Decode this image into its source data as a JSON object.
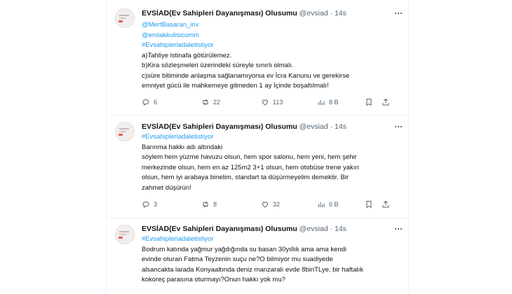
{
  "tweets": [
    {
      "name": "EVSİAD(Ev Sahipleri Dayanışması) Olusumu",
      "handle": "@evsiad",
      "sep": "·",
      "time": "14s",
      "lines": [
        {
          "text": "@MertBasaran_inv",
          "link": true
        },
        {
          "text": "@emlakkulisicomm",
          "link": true
        },
        {
          "text": "#Evsahipleriadaletistiyor",
          "link": true
        },
        {
          "text": "a)Tahliye istinafa götürülemez.",
          "link": false
        },
        {
          "text": "b)Kira sözleşmeleri üzerindeki süreyle sınırlı olmalı.",
          "link": false
        },
        {
          "text": "c)süre bitiminde anlaşma sağlanamıyorsa ev İcra Kanunu ve gerekirse",
          "link": false
        },
        {
          "text": "emniyet gücü ile mahkemeye gitmeden 1 ay İçinde boşaltılmalı!",
          "link": false
        }
      ],
      "replies": "6",
      "retweets": "22",
      "likes": "113",
      "views": "8 B"
    },
    {
      "name": "EVSİAD(Ev Sahipleri Dayanışması) Olusumu",
      "handle": "@evsiad",
      "sep": "·",
      "time": "14s",
      "lines": [
        {
          "text": "#Evsahipleriadaletistiyor",
          "link": true
        },
        {
          "text": "Barınma hakkı adı altındaki",
          "link": false
        },
        {
          "text": "söylem hem yüzme havuzu olsun, hem spor salonu, hem yeni, hem şehir",
          "link": false
        },
        {
          "text": "merkezinde olsun, hem en az 125m2 3+1 olsun, hem otobüse trene yakın",
          "link": false
        },
        {
          "text": "olsun, hem iyi arabaya binelim, standart ta düşürmeyelim demektir. Bir",
          "link": false
        },
        {
          "text": "zahmet düşürün!",
          "link": false
        }
      ],
      "replies": "3",
      "retweets": "8",
      "likes": "32",
      "views": "6 B"
    },
    {
      "name": "EVSİAD(Ev Sahipleri Dayanışması) Olusumu",
      "handle": "@evsiad",
      "sep": "·",
      "time": "14s",
      "lines": [
        {
          "text": "#Evsahipleriadaletistiyor",
          "link": true
        },
        {
          "text": "Bodrum katında yağmur yağdığında su basan 30yıllık ama ama kendi",
          "link": false
        },
        {
          "text": "evinde oturan Fatma Teyzenin suçu ne?O bilmiyor mu suadiyede",
          "link": false
        },
        {
          "text": "alsancakta larada Konyaaltında deniz manzaralı evde 8binTLye, bir haftalık",
          "link": false
        },
        {
          "text": "kokoreç parasına oturmayı?Onun hakkı yok mu?",
          "link": false
        }
      ]
    }
  ],
  "icons": {
    "more": "more-icon",
    "reply": "reply-icon",
    "retweet": "retweet-icon",
    "like": "heart-icon",
    "views": "views-icon",
    "bookmark": "bookmark-icon",
    "share": "share-icon"
  },
  "colors": {
    "link": "#1d9bf0",
    "muted": "#536471",
    "text": "#0f1419"
  }
}
